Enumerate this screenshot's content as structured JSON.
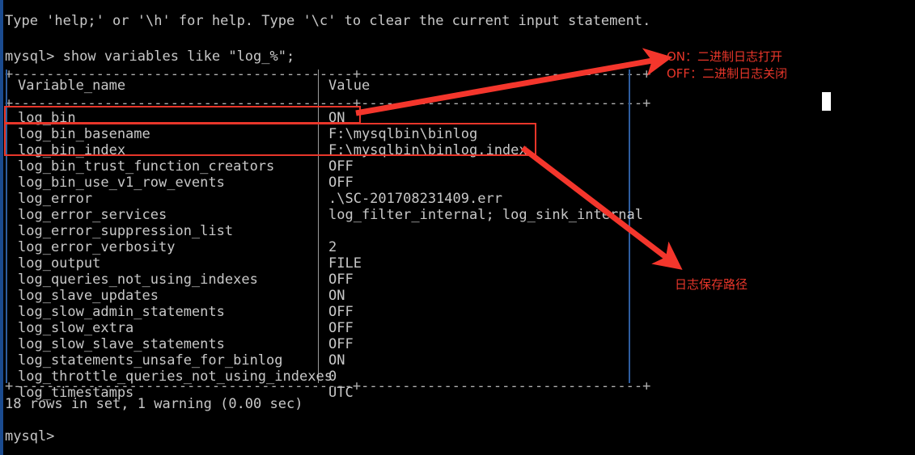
{
  "terminal": {
    "help_line": "Type 'help;' or '\\h' for help. Type '\\c' to clear the current input statement.",
    "prompt_command": "mysql> show variables like \"log_%\";",
    "result_status": "18 rows in set, 1 warning (0.00 sec)",
    "final_prompt": "mysql>",
    "foreground_color": "#c8c8c8",
    "background_color": "#000000"
  },
  "table": {
    "rule_top": "+-----------------------------------------+----------------------------------+",
    "rule_header": "+-----------------------------------------+----------------------------------+",
    "rule_bottom": "+-----------------------------------------+----------------------------------+",
    "headers": {
      "name": "Variable_name",
      "value": "Value"
    },
    "rows": [
      {
        "name": "log_bin",
        "value": "ON"
      },
      {
        "name": "log_bin_basename",
        "value": "F:\\mysqlbin\\binlog"
      },
      {
        "name": "log_bin_index",
        "value": "F:\\mysqlbin\\binlog.index"
      },
      {
        "name": "log_bin_trust_function_creators",
        "value": "OFF"
      },
      {
        "name": "log_bin_use_v1_row_events",
        "value": "OFF"
      },
      {
        "name": "log_error",
        "value": ".\\SC-201708231409.err"
      },
      {
        "name": "log_error_services",
        "value": "log_filter_internal; log_sink_internal"
      },
      {
        "name": "log_error_suppression_list",
        "value": ""
      },
      {
        "name": "log_error_verbosity",
        "value": "2"
      },
      {
        "name": "log_output",
        "value": "FILE"
      },
      {
        "name": "log_queries_not_using_indexes",
        "value": "OFF"
      },
      {
        "name": "log_slave_updates",
        "value": "ON"
      },
      {
        "name": "log_slow_admin_statements",
        "value": "OFF"
      },
      {
        "name": "log_slow_extra",
        "value": "OFF"
      },
      {
        "name": "log_slow_slave_statements",
        "value": "OFF"
      },
      {
        "name": "log_statements_unsafe_for_binlog",
        "value": "ON"
      },
      {
        "name": "log_throttle_queries_not_using_indexes",
        "value": "0"
      },
      {
        "name": "log_timestamps",
        "value": "UTC"
      }
    ]
  },
  "annotations": {
    "accent_color": "#e8362a",
    "note_binlog_on": "ON：二进制日志打开",
    "note_binlog_off": "OFF：二进制日志关闭",
    "note_log_path": "日志保存路径"
  }
}
